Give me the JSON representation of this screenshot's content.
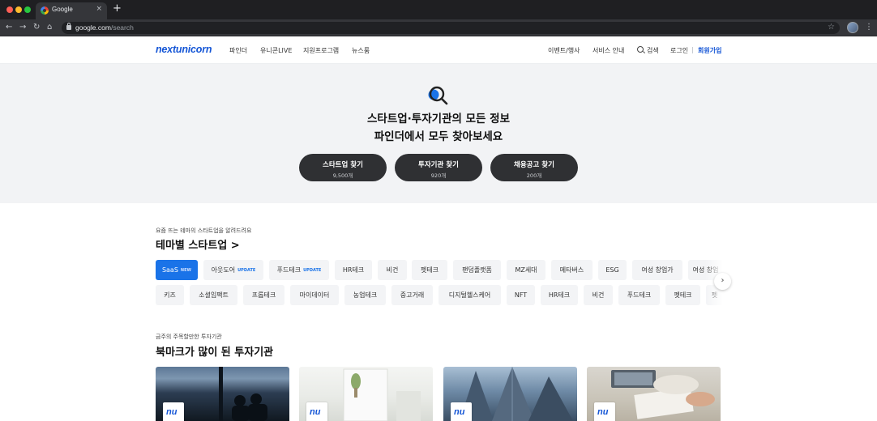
{
  "browser": {
    "tab_title": "Google",
    "tab_close": "×",
    "new_tab": "+",
    "url_host": "google.com",
    "url_path": "/search",
    "back": "←",
    "forward": "→",
    "reload": "↻",
    "home": "⌂",
    "star": "☆",
    "menu": "⋮"
  },
  "header": {
    "logo": "nextunicorn",
    "nav": [
      "파인더",
      "유니콘LIVE",
      "지원프로그램",
      "뉴스룸"
    ],
    "events": "이벤트/행사",
    "service_info": "서비스 안내",
    "search": "검색",
    "login": "로그인",
    "signup": "회원가입",
    "brand_color": "#1556d6"
  },
  "hero": {
    "title_line1": "스타트업·투자기관의 모든 정보",
    "title_line2": "파인더에서 모두 찾아보세요",
    "buttons": [
      {
        "label": "스타트업 찾기",
        "count": "9,500개"
      },
      {
        "label": "투자기관 찾기",
        "count": "920개"
      },
      {
        "label": "채용공고 찾기",
        "count": "200개"
      }
    ]
  },
  "themes": {
    "subtitle": "요즘 뜨는 테마의 스타트업을 알려드려요",
    "title": "테마별 스타트업 >",
    "row1": [
      {
        "label": "SaaS",
        "tag": "NEW"
      },
      {
        "label": "아웃도어",
        "tag": "UPDATE"
      },
      {
        "label": "푸드테크",
        "tag": "UPDATE"
      },
      {
        "label": "HR테크",
        "tag": ""
      },
      {
        "label": "비건",
        "tag": ""
      },
      {
        "label": "펫테크",
        "tag": ""
      },
      {
        "label": "팬덤플랫폼",
        "tag": ""
      },
      {
        "label": "MZ세대",
        "tag": ""
      },
      {
        "label": "메타버스",
        "tag": ""
      },
      {
        "label": "ESG",
        "tag": ""
      },
      {
        "label": "여성 창업가",
        "tag": ""
      },
      {
        "label": "여성 창업",
        "tag": ""
      }
    ],
    "row2": [
      "키즈",
      "소셜임팩트",
      "프롭테크",
      "마이데이터",
      "농업테크",
      "중고거래",
      "디지털헬스케어",
      "NFT",
      "HR테크",
      "비건",
      "푸드테크",
      "펫테크",
      "펫"
    ],
    "next": "›",
    "accent": "#1a73e8"
  },
  "investors": {
    "subtitle": "금주의 주목할만한 투자기관",
    "title": "북마크가 많이 된 투자기관",
    "badge_text": "nu"
  }
}
